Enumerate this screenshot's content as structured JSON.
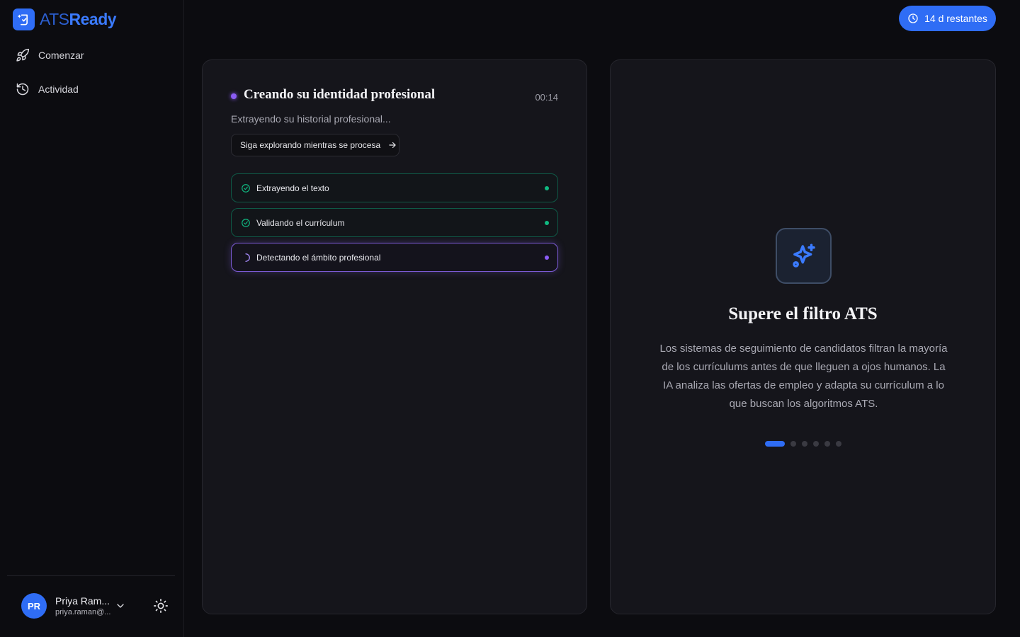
{
  "brand": {
    "name_part1": "ATS",
    "name_part2": "Ready"
  },
  "nav": {
    "items": [
      {
        "label": "Comenzar",
        "icon": "rocket-icon"
      },
      {
        "label": "Actividad",
        "icon": "history-icon"
      }
    ]
  },
  "user": {
    "initials": "PR",
    "name": "Priya Ram...",
    "email": "priya.raman@..."
  },
  "trial": {
    "label": "14 d restantes"
  },
  "processing": {
    "title": "Creando su identidad profesional",
    "timer": "00:14",
    "subtitle": "Extrayendo su historial profesional...",
    "explore_label": "Siga explorando mientras se procesa",
    "steps": [
      {
        "label": "Extrayendo el texto",
        "status": "done"
      },
      {
        "label": "Validando el currículum",
        "status": "done"
      },
      {
        "label": "Detectando el ámbito profesional",
        "status": "in-progress"
      }
    ]
  },
  "feature": {
    "icon": "sparkles-icon",
    "title": "Supere el filtro ATS",
    "description": "Los sistemas de seguimiento de candidatos filtran la mayoría de los currículums antes de que lleguen a ojos humanos. La IA analiza las ofertas de empleo y adapta su currículum a lo que buscan los algoritmos ATS.",
    "slide_count": 6,
    "active_slide": 1
  },
  "colors": {
    "accent": "#2f6df5",
    "success": "#10b981",
    "progress": "#8b5cf6",
    "background": "#0c0c10",
    "card": "#15151b"
  }
}
